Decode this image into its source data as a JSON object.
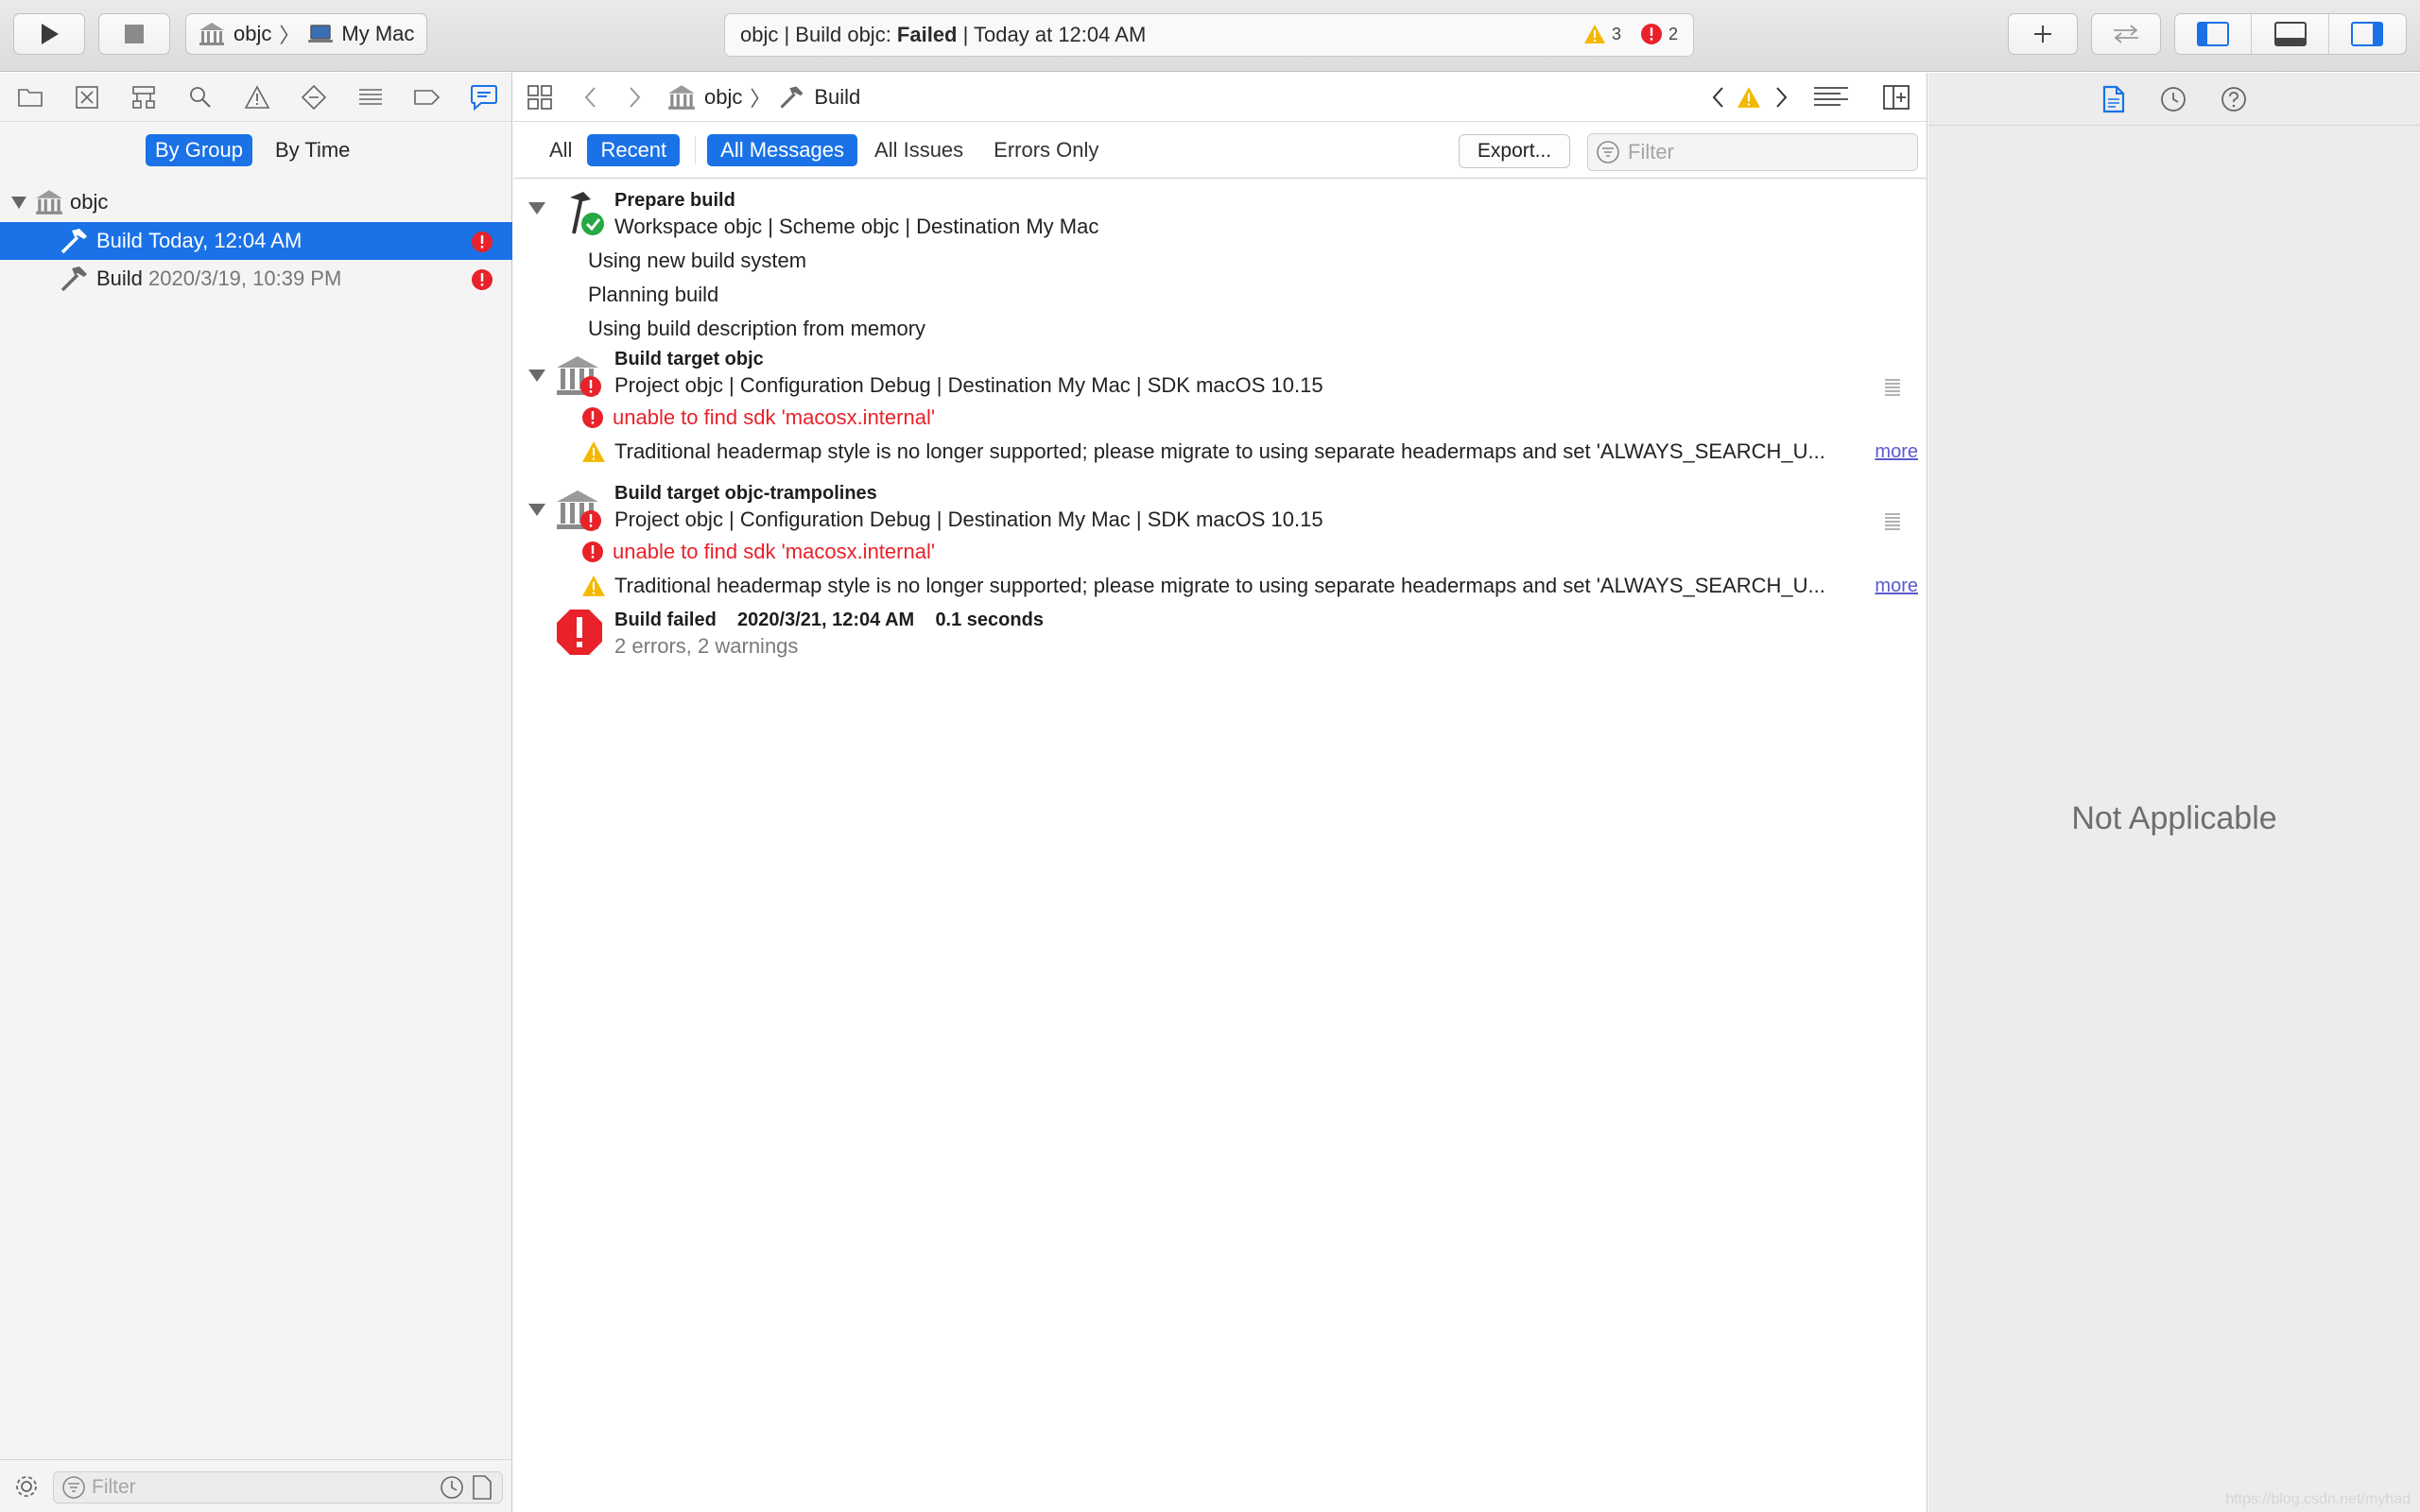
{
  "toolbar": {
    "scheme": {
      "project": "objc",
      "destination": "My Mac"
    },
    "activity": {
      "prefix": "objc | Build objc: ",
      "status": "Failed",
      "suffix": " | Today at 12:04 AM",
      "warning_count": "3",
      "error_count": "2"
    }
  },
  "navigator": {
    "grouping": {
      "by_group": "By Group",
      "by_time": "By Time"
    },
    "tree": {
      "root": "objc",
      "builds": [
        {
          "name": "Build",
          "time": "Today, 12:04 AM"
        },
        {
          "name": "Build",
          "time": "2020/3/19, 10:39 PM"
        }
      ]
    },
    "filter_placeholder": "Filter"
  },
  "editor": {
    "breadcrumb": {
      "project": "objc",
      "item": "Build"
    },
    "filterbar": {
      "all": "All",
      "recent": "Recent",
      "all_messages": "All Messages",
      "all_issues": "All Issues",
      "errors_only": "Errors Only",
      "export": "Export...",
      "filter_placeholder": "Filter"
    },
    "log": {
      "prepare": {
        "title": "Prepare build",
        "subtitle": "Workspace objc | Scheme objc | Destination My Mac",
        "lines": [
          "Using new build system",
          "Planning build",
          "Using build description from memory"
        ]
      },
      "targets": [
        {
          "title": "Build target objc",
          "subtitle": "Project objc | Configuration Debug | Destination My Mac | SDK macOS 10.15",
          "error": "unable to find sdk 'macosx.internal'",
          "warning": "Traditional headermap style is no longer supported; please migrate to using separate headermaps and set 'ALWAYS_SEARCH_U...",
          "more": "more"
        },
        {
          "title": "Build target objc-trampolines",
          "subtitle": "Project objc | Configuration Debug | Destination My Mac | SDK macOS 10.15",
          "error": "unable to find sdk 'macosx.internal'",
          "warning": "Traditional headermap style is no longer supported; please migrate to using separate headermaps and set 'ALWAYS_SEARCH_U...",
          "more": "more"
        }
      ],
      "result": {
        "title": "Build failed",
        "date": "2020/3/21, 12:04 AM",
        "duration": "0.1 seconds",
        "summary": "2 errors, 2 warnings"
      }
    }
  },
  "inspector": {
    "empty_text": "Not Applicable"
  },
  "watermark": "https://blog.csdn.net/myhad",
  "colors": {
    "accent": "#1a72e6",
    "error": "#e8212a",
    "warning": "#f5b800",
    "success": "#27a845"
  }
}
